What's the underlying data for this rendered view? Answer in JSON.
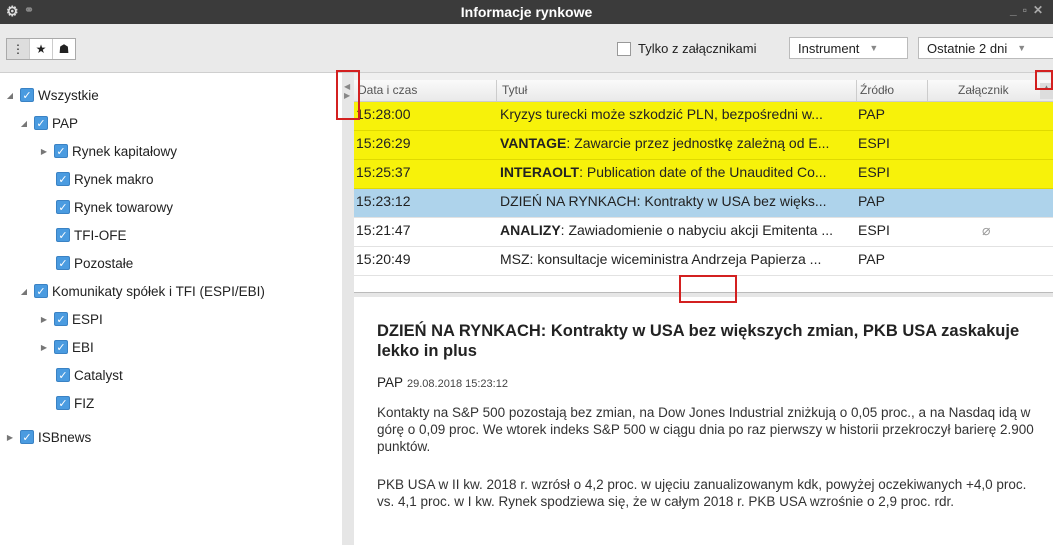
{
  "window": {
    "title": "Informacje rynkowe"
  },
  "toolbar": {
    "attachments_only_label": "Tylko z załącznikami",
    "instrument_dropdown": "Instrument",
    "period_dropdown": "Ostatnie 2 dni"
  },
  "tree": {
    "all": "Wszystkie",
    "pap": "PAP",
    "rynek_kapitalowy": "Rynek kapitałowy",
    "rynek_makro": "Rynek makro",
    "rynek_towarowy": "Rynek towarowy",
    "tfi_ofe": "TFI-OFE",
    "pozostale": "Pozostałe",
    "komunikaty": "Komunikaty spółek i TFI (ESPI/EBI)",
    "espi": "ESPI",
    "ebi": "EBI",
    "catalyst": "Catalyst",
    "fiz": "FIZ",
    "isbnews": "ISBnews"
  },
  "grid": {
    "headers": {
      "time": "Data i czas",
      "title": "Tytuł",
      "source": "Źródło",
      "attachment": "Załącznik"
    },
    "rows": [
      {
        "time": "15:28:00",
        "title_bold": "",
        "title": "Kryzys turecki może szkodzić PLN, bezpośredni w...",
        "source": "PAP",
        "attachment": false,
        "style": "yellow"
      },
      {
        "time": "15:26:29",
        "title_bold": "VANTAGE",
        "title": ": Zawarcie przez jednostkę zależną od E...",
        "source": "ESPI",
        "attachment": false,
        "style": "yellow"
      },
      {
        "time": "15:25:37",
        "title_bold": "INTERAOLT",
        "title": ": Publication date of the Unaudited Co...",
        "source": "ESPI",
        "attachment": false,
        "style": "yellow"
      },
      {
        "time": "15:23:12",
        "title_bold": "",
        "title": "DZIEŃ NA RYNKACH: Kontrakty w USA bez więks...",
        "source": "PAP",
        "attachment": false,
        "style": "selected"
      },
      {
        "time": "15:21:47",
        "title_bold": "ANALIZY",
        "title": ": Zawiadomienie o nabyciu akcji Emitenta ...",
        "source": "ESPI",
        "attachment": true,
        "style": "normal"
      },
      {
        "time": "15:20:49",
        "title_bold": "",
        "title": "MSZ: konsultacje wiceministra Andrzeja Papierza ...",
        "source": "PAP",
        "attachment": false,
        "style": "normal"
      }
    ]
  },
  "article": {
    "title": "DZIEŃ NA RYNKACH: Kontrakty w USA bez większych zmian, PKB USA zaskakuje lekko in plus",
    "source": "PAP",
    "datetime": "29.08.2018 15:23:12",
    "paragraph1": "Kontakty na S&P 500 pozostają bez zmian, na Dow Jones Industrial zniżkują o 0,05 proc., a na Nasdaq idą w górę o 0,09 proc. We wtorek indeks S&P 500 w ciągu dnia po raz pierwszy w historii przekroczył barierę 2.900 punktów.",
    "paragraph2": "PKB USA w II kw. 2018 r. wzrósł o 4,2 proc. w ujęciu zanualizowanym kdk, powyżej oczekiwanych +4,0 proc. vs. 4,1 proc. w I kw. Rynek spodziewa się, że w całym 2018 r. PKB USA wzrośnie o 2,9 proc. rdr."
  }
}
